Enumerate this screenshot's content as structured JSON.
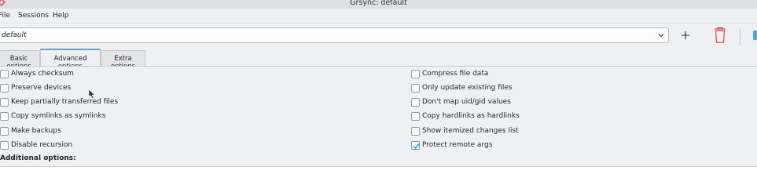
{
  "window": {
    "title": "Grsync: default"
  },
  "menu": [
    "File",
    "Sessions",
    "Help"
  ],
  "session": {
    "value": "default"
  },
  "toolbar_icons": [
    "plus-icon",
    "trash-icon",
    "extra-icon"
  ],
  "tabs": [
    {
      "label": "Basic options",
      "active": false
    },
    {
      "label": "Advanced options",
      "active": true
    },
    {
      "label": "Extra options",
      "active": false
    }
  ],
  "options_left": [
    {
      "label": "Always checksum",
      "checked": false
    },
    {
      "label": "Preserve devices",
      "checked": false
    },
    {
      "label": "Keep partially transferred files",
      "checked": false
    },
    {
      "label": "Copy symlinks as symlinks",
      "checked": false
    },
    {
      "label": "Make backups",
      "checked": false
    },
    {
      "label": "Disable recursion",
      "checked": false
    }
  ],
  "options_right": [
    {
      "label": "Compress file data",
      "checked": false
    },
    {
      "label": "Only update existing files",
      "checked": false
    },
    {
      "label": "Don't map uid/gid values",
      "checked": false
    },
    {
      "label": "Copy hardlinks as hardlinks",
      "checked": false
    },
    {
      "label": "Show itemized changes list",
      "checked": false
    },
    {
      "label": "Protect remote args",
      "checked": true
    }
  ],
  "additional_options_label": "Additional options:",
  "colors": {
    "accent": "#3daee9",
    "trash": "#da4453",
    "background": "#eff0f1"
  }
}
